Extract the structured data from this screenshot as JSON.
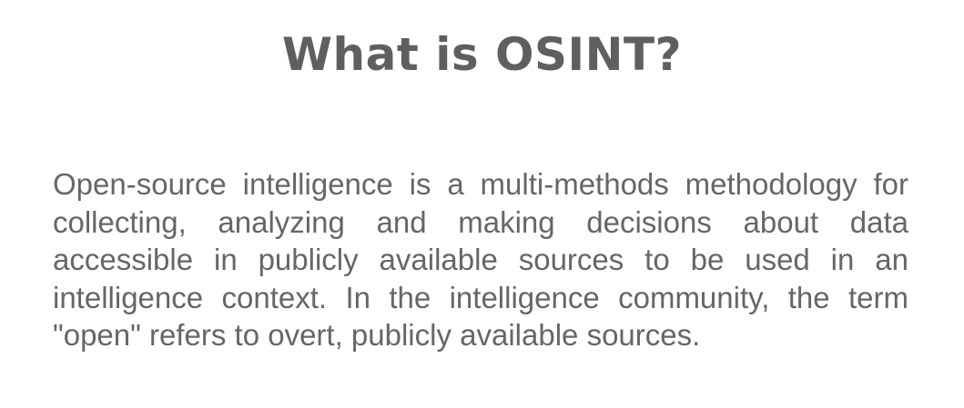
{
  "heading": {
    "title": "What is OSINT?"
  },
  "content": {
    "paragraph": "Open-source intelligence is a multi-methods methodology for collecting, analyzing and making decisions about data accessible in publicly available sources to be used in an intelligence context. In the intelligence community, the term \"open\" refers to overt, publicly available sources."
  },
  "colors": {
    "title": "#5f5f5f",
    "text": "#666666",
    "background": "#ffffff"
  }
}
